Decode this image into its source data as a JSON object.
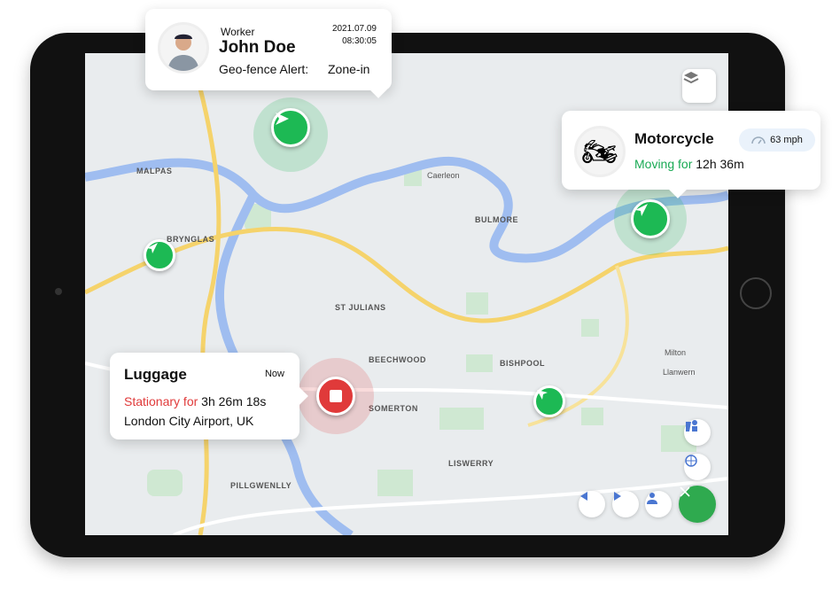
{
  "worker_card": {
    "role": "Worker",
    "name": "John Doe",
    "date": "2021.07.09",
    "time": "08:30:05",
    "alert_label": "Geo-fence Alert:",
    "alert_value": "Zone-in"
  },
  "vehicle_card": {
    "name": "Motorcycle",
    "speed": "63 mph",
    "status_label": "Moving for",
    "duration": "12h 36m"
  },
  "luggage_card": {
    "name": "Luggage",
    "time": "Now",
    "status_label": "Stationary for",
    "duration": "3h 26m 18s",
    "location": "London City Airport, UK"
  },
  "map_labels": [
    "MALPAS",
    "BRYNGLAS",
    "Caerleon",
    "BULMORE",
    "ST JULIANS",
    "BEECHWOOD",
    "BISHPOOL",
    "SOMERTON",
    "Milton",
    "Llanwern",
    "LISWERRY",
    "PILLGWENLLY"
  ],
  "colors": {
    "green": "#1db954",
    "red": "#e03a3a",
    "blue": "#4a76d1"
  },
  "icons": [
    "layers-icon",
    "speedometer-icon",
    "navigation-arrow-icon",
    "stop-icon",
    "street-view-icon",
    "crosshair-icon",
    "chevron-left-icon",
    "chevron-right-icon",
    "person-icon",
    "close-icon"
  ]
}
